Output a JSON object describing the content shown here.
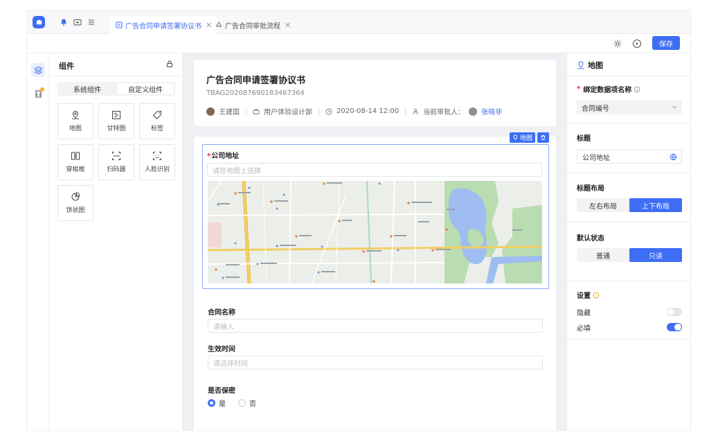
{
  "colors": {
    "accent": "#3d6ef5",
    "panel": "#ffffff",
    "canvas": "#eef0f3"
  },
  "tabs": [
    {
      "label": "广告合同申请签署协议书",
      "icon": "form-icon",
      "active": true
    },
    {
      "label": "广告合同审批流程",
      "icon": "flow-icon",
      "active": false
    }
  ],
  "toolbar": {
    "save_label": "保存"
  },
  "components": {
    "title": "组件",
    "segments": [
      "系统组件",
      "自定义组件"
    ],
    "items": [
      {
        "label": "地图",
        "icon": "map-pin-icon"
      },
      {
        "label": "甘特图",
        "icon": "gantt-icon"
      },
      {
        "label": "标签",
        "icon": "tag-icon"
      },
      {
        "label": "穿梭框",
        "icon": "transfer-icon"
      },
      {
        "label": "扫码器",
        "icon": "scan-icon"
      },
      {
        "label": "人脸识别",
        "icon": "face-scan-icon"
      },
      {
        "label": "饼状图",
        "icon": "pie-chart-icon"
      }
    ]
  },
  "document": {
    "title": "广告合同申请签署协议书",
    "code": "TBAG202087690183467364",
    "author": "王建国",
    "department": "用户体验设计部",
    "datetime": "2020-08-14 12:00",
    "approver_label": "当前审批人：",
    "approver": "张晓非"
  },
  "form": {
    "map_badge": "地图",
    "fields": {
      "address": {
        "label": "公司地址",
        "placeholder": "请在地图上选择"
      },
      "contract_name": {
        "label": "合同名称",
        "placeholder": "请输入"
      },
      "effective_time": {
        "label": "生效时间",
        "placeholder": "请选择时间"
      },
      "confidential": {
        "label": "是否保密",
        "options": [
          "是",
          "否"
        ],
        "selected": "是"
      }
    }
  },
  "properties": {
    "header": "地图",
    "bind_label": "绑定数据项名称",
    "bind_value": "合同编号",
    "title_label": "标题",
    "title_value": "公司地址",
    "layout_label": "标题布局",
    "layout_options": [
      "左右布局",
      "上下布局"
    ],
    "layout_selected": "上下布局",
    "state_label": "默认状态",
    "state_options": [
      "普通",
      "只读"
    ],
    "state_selected": "只读",
    "settings_label": "设置",
    "hidden_label": "隐藏",
    "hidden_on": false,
    "required_label": "必填",
    "required_on": true
  }
}
